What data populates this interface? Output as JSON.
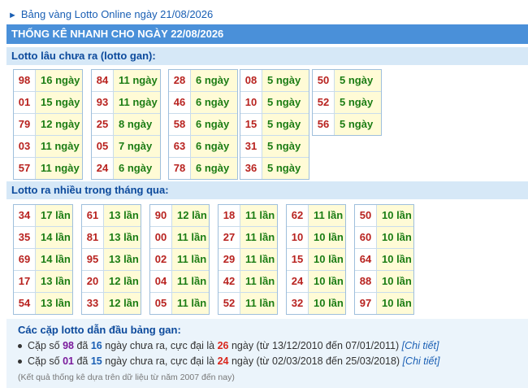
{
  "top_link": "Bảng vàng Lotto Online ngày 21/08/2026",
  "header_title": "THỐNG KÊ NHANH CHO NGÀY 22/08/2026",
  "gan": {
    "title": "Lotto lâu chưa ra (lotto gan):",
    "columns": [
      [
        {
          "n": "98",
          "v": "16 ngày"
        },
        {
          "n": "01",
          "v": "15 ngày"
        },
        {
          "n": "79",
          "v": "12 ngày"
        },
        {
          "n": "03",
          "v": "11 ngày"
        },
        {
          "n": "57",
          "v": "11 ngày"
        }
      ],
      [
        {
          "n": "84",
          "v": "11 ngày"
        },
        {
          "n": "93",
          "v": "11 ngày"
        },
        {
          "n": "25",
          "v": "8 ngày"
        },
        {
          "n": "05",
          "v": "7 ngày"
        },
        {
          "n": "24",
          "v": "6 ngày"
        }
      ],
      [
        {
          "n": "28",
          "v": "6 ngày"
        },
        {
          "n": "46",
          "v": "6 ngày"
        },
        {
          "n": "58",
          "v": "6 ngày"
        },
        {
          "n": "63",
          "v": "6 ngày"
        },
        {
          "n": "78",
          "v": "6 ngày"
        }
      ],
      [
        {
          "n": "08",
          "v": "5 ngày"
        },
        {
          "n": "10",
          "v": "5 ngày"
        },
        {
          "n": "15",
          "v": "5 ngày"
        },
        {
          "n": "31",
          "v": "5 ngày"
        },
        {
          "n": "36",
          "v": "5 ngày"
        }
      ],
      [
        {
          "n": "50",
          "v": "5 ngày"
        },
        {
          "n": "52",
          "v": "5 ngày"
        },
        {
          "n": "56",
          "v": "5 ngày"
        }
      ]
    ]
  },
  "freq": {
    "title": "Lotto ra nhiều trong tháng qua:",
    "columns": [
      [
        {
          "n": "34",
          "v": "17 lần"
        },
        {
          "n": "35",
          "v": "14 lần"
        },
        {
          "n": "69",
          "v": "14 lần"
        },
        {
          "n": "17",
          "v": "13 lần"
        },
        {
          "n": "54",
          "v": "13 lần"
        }
      ],
      [
        {
          "n": "61",
          "v": "13 lần"
        },
        {
          "n": "81",
          "v": "13 lần"
        },
        {
          "n": "95",
          "v": "13 lần"
        },
        {
          "n": "20",
          "v": "12 lần"
        },
        {
          "n": "33",
          "v": "12 lần"
        }
      ],
      [
        {
          "n": "90",
          "v": "12 lần"
        },
        {
          "n": "00",
          "v": "11 lần"
        },
        {
          "n": "02",
          "v": "11 lần"
        },
        {
          "n": "04",
          "v": "11 lần"
        },
        {
          "n": "05",
          "v": "11 lần"
        }
      ],
      [
        {
          "n": "18",
          "v": "11 lần"
        },
        {
          "n": "27",
          "v": "11 lần"
        },
        {
          "n": "29",
          "v": "11 lần"
        },
        {
          "n": "42",
          "v": "11 lần"
        },
        {
          "n": "52",
          "v": "11 lần"
        }
      ],
      [
        {
          "n": "62",
          "v": "11 lần"
        },
        {
          "n": "10",
          "v": "10 lần"
        },
        {
          "n": "15",
          "v": "10 lần"
        },
        {
          "n": "24",
          "v": "10 lần"
        },
        {
          "n": "32",
          "v": "10 lần"
        }
      ],
      [
        {
          "n": "50",
          "v": "10 lần"
        },
        {
          "n": "60",
          "v": "10 lần"
        },
        {
          "n": "64",
          "v": "10 lần"
        },
        {
          "n": "88",
          "v": "10 lần"
        },
        {
          "n": "97",
          "v": "10 lần"
        }
      ]
    ]
  },
  "pairs": {
    "title": "Các cặp lotto dẫn đầu bảng gan:",
    "items": [
      {
        "prefix": "Cặp số ",
        "num": "98",
        "mid1": " đã ",
        "days": "16",
        "mid2": " ngày chưa ra, cực đại là ",
        "max": "26",
        "suffix": " ngày (từ 13/12/2010 đến 07/01/2011) ",
        "link": "[Chi tiết]"
      },
      {
        "prefix": "Cặp số ",
        "num": "01",
        "mid1": " đã ",
        "days": "15",
        "mid2": " ngày chưa ra, cực đại là ",
        "max": "24",
        "suffix": " ngày (từ 02/03/2018 đến 25/03/2018) ",
        "link": "[Chi tiết]"
      }
    ],
    "note": "(Kết quả thống kê dựa trên dữ liệu từ năm 2007 đến nay)"
  }
}
